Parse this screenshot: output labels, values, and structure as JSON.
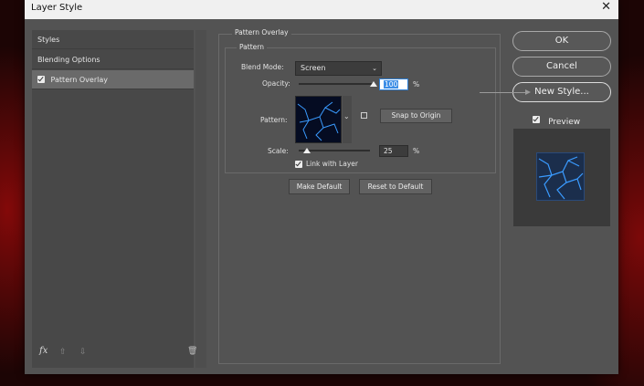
{
  "window": {
    "title": "Layer Style",
    "close_glyph": "✕"
  },
  "sidebar": {
    "items": [
      {
        "label": "Styles",
        "selected": false,
        "checkbox": false
      },
      {
        "label": "Blending Options",
        "selected": false,
        "checkbox": false
      },
      {
        "label": "Pattern Overlay",
        "selected": true,
        "checkbox": true
      }
    ],
    "footer": {
      "fx": "fx",
      "up_icon": "⇧",
      "down_icon": "⇩",
      "trash_icon": "🗑"
    }
  },
  "pattern_overlay": {
    "section_title": "Pattern Overlay",
    "group_title": "Pattern",
    "blend_mode_label": "Blend Mode:",
    "blend_mode_value": "Screen",
    "opacity_label": "Opacity:",
    "opacity_value": "100",
    "opacity_unit": "%",
    "opacity_level": 1.0,
    "pattern_label": "Pattern:",
    "snap_button": "Snap to Origin",
    "scale_label": "Scale:",
    "scale_value": "25",
    "scale_unit": "%",
    "scale_level": 0.12,
    "link_label": "Link with Layer",
    "make_default_button": "Make Default",
    "reset_default_button": "Reset to Default"
  },
  "actions": {
    "ok_button": "OK",
    "cancel_button": "Cancel",
    "new_style_button": "New Style...",
    "preview_label": "Preview",
    "preview_checked": true
  },
  "colors": {
    "dialog_bg": "#535353",
    "pattern_line": "#3a9bff",
    "pattern_bg": "#050c22"
  }
}
